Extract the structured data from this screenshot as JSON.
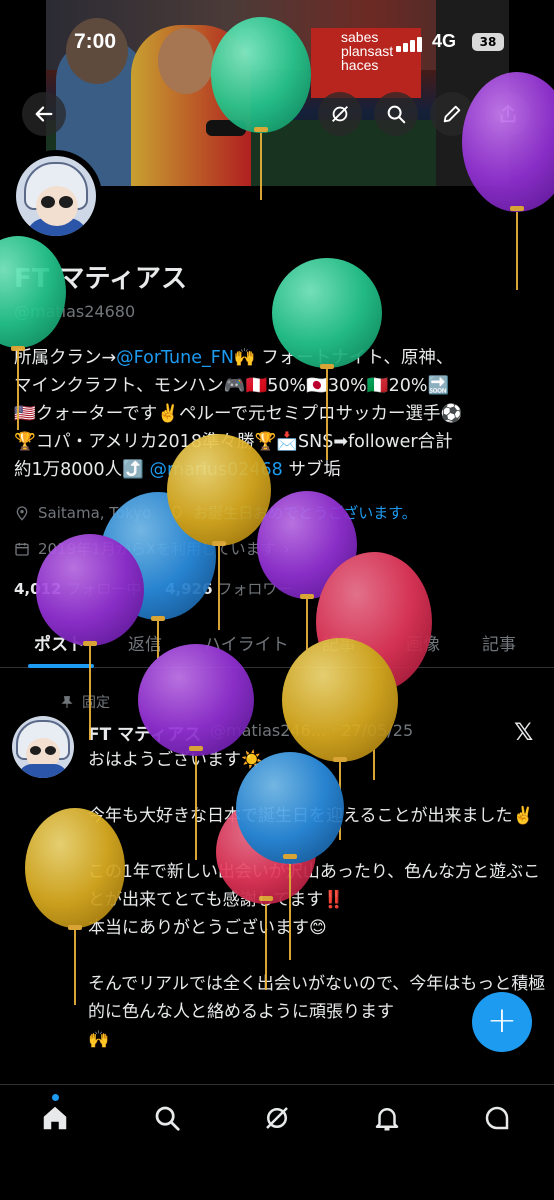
{
  "status_bar": {
    "time": "7:00",
    "network": "4G",
    "battery": "38"
  },
  "banner": {
    "sign_text": "sabes\nplansast\nhaces"
  },
  "profile": {
    "name": "FT マティアス",
    "handle": "@matias24680",
    "bio_line1_a": "所属クラン→",
    "bio_line1_link": "@ForTune_FN",
    "bio_line1_b": "🙌 フォートナイト、原神、",
    "bio_line2": "マインクラフト、モンハン🎮🇵🇪50%🇯🇵30%🇮🇹20%🔜",
    "bio_line3": "🇺🇸クォーターです✌️ペルーで元セミプロサッカー選手⚽",
    "bio_line4": "🏆コパ・アメリカ2018準々勝🏆📩SNS➡follower合計",
    "bio_line5_a": "約1万8000人⤴️ ",
    "bio_line5_link": "@marius02468",
    "bio_line5_b": " サブ垢",
    "location": "Saitama, Tokyo",
    "birthday": "お誕生日おめでとうございます。",
    "joined": "2019年1月からXを利用しています",
    "following_count": "4,012",
    "following_label": "フォロー中",
    "followers_count": "4,926",
    "followers_label": "フォロワー"
  },
  "tabs": [
    {
      "label": "ポスト"
    },
    {
      "label": "返信"
    },
    {
      "label": "ハイライト"
    },
    {
      "label": "記事"
    },
    {
      "label": "画像"
    },
    {
      "label": "記事"
    }
  ],
  "pinned_post": {
    "pinned_label": "固定",
    "author": "FT マティアス",
    "meta": "@matias246... · 27/05/25",
    "body": "おはようございます☀️\n\n今年も大好きな日本で誕生日を迎えることが出来ました✌️\n\nこの1年で新しい出会いが沢山あったり、色んな方と遊ぶことが出来てとても感謝してます",
    "body_emoji": "‼️",
    "body2": "\n本当にありがとうございます😊\n\nそんでリアルでは全く出会いがないので、今年はもっと積極的に色んな人と絡めるように頑張ります\n🙌"
  },
  "fab": {
    "label": "+"
  },
  "icons": {
    "back": "back-arrow-icon",
    "grok": "grok-icon",
    "search": "search-icon",
    "edit": "edit-icon",
    "share": "share-icon",
    "home": "home-icon",
    "explore": "search-icon",
    "grok_nav": "grok-icon",
    "notifications": "bell-icon",
    "messages": "message-icon"
  },
  "colors": {
    "accent": "#1d9bf0",
    "balloon_green": "#2ed3a0",
    "balloon_purple": "#9b35d8",
    "balloon_yellow": "#e0b52a",
    "balloon_blue": "#2f8fe0",
    "balloon_red": "#e83a5c"
  }
}
